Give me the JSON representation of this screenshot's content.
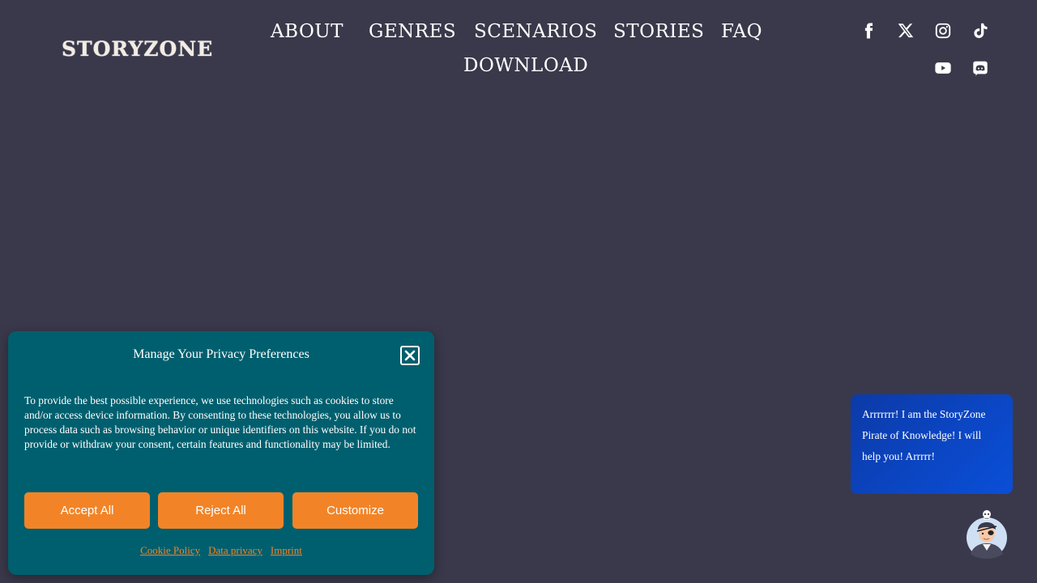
{
  "header": {
    "logo": "STORYZONE",
    "nav": [
      {
        "label": "ABOUT"
      },
      {
        "label": "GENRES"
      },
      {
        "label": "SCENARIOS"
      },
      {
        "label": "STORIES"
      },
      {
        "label": "FAQ"
      },
      {
        "label": "DOWNLOAD"
      }
    ],
    "social": [
      {
        "icon": "facebook-icon"
      },
      {
        "icon": "x-icon"
      },
      {
        "icon": "instagram-icon"
      },
      {
        "icon": "tiktok-icon"
      },
      {
        "icon": "youtube-icon"
      },
      {
        "icon": "discord-icon"
      }
    ]
  },
  "privacy": {
    "title": "Manage Your Privacy Preferences",
    "text": "To provide the best possible experience, we use technologies such as cookies to store and/or access device information. By consenting to these technologies, you allow us to process data such as browsing behavior or unique identifiers on this website. If you do not provide or withdraw your consent, certain features and functionality may be limited.",
    "accept_label": "Accept All",
    "reject_label": "Reject All",
    "customize_label": "Customize",
    "links": [
      "Cookie Policy",
      "Data privacy",
      "Imprint"
    ]
  },
  "chat": {
    "message": "Arrrrrrr! I am the StoryZone Pirate of Knowledge! I will help you! Arrrrr!"
  },
  "colors": {
    "background": "#3a394b",
    "modal": "#005f6e",
    "accent": "#f28427",
    "chat": "#0a4fd8"
  }
}
